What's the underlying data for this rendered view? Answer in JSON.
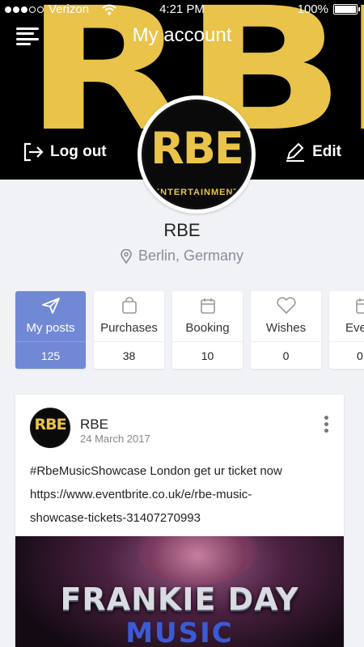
{
  "status_bar": {
    "carrier": "Verizon",
    "time": "4:21 PM",
    "battery": "100%",
    "battery_level": 1.0,
    "signal_bars_filled": 3,
    "signal_bars_total": 5
  },
  "header": {
    "title": "My account",
    "cover_text": "RBE",
    "logout_label": "Log out",
    "edit_label": "Edit"
  },
  "profile": {
    "avatar_text": "RBE",
    "avatar_subtext": "ENTERTAINMENT",
    "name": "RBE",
    "location": "Berlin, Germany"
  },
  "stats": [
    {
      "label": "My posts",
      "value": "125",
      "icon": "send-icon",
      "active": true
    },
    {
      "label": "Purchases",
      "value": "38",
      "icon": "bag-icon",
      "active": false
    },
    {
      "label": "Booking",
      "value": "10",
      "icon": "calendar-icon",
      "active": false
    },
    {
      "label": "Wishes",
      "value": "0",
      "icon": "heart-icon",
      "active": false
    },
    {
      "label": "Eve",
      "value": "0",
      "icon": "calendar-icon",
      "active": false
    }
  ],
  "post": {
    "author": "RBE",
    "avatar_text": "RBE",
    "date": "24 March 2017",
    "text_line1": "#RbeMusicShowcase London get ur ticket now",
    "text_line2": "https://www.eventbrite.co.uk/e/rbe-music-",
    "text_line3": "showcase-tickets-31407270993",
    "image_headline": "FRANKIE DAY",
    "image_sub": "MUSIC"
  },
  "colors": {
    "accent": "#7189d4",
    "brand_yellow": "#e9c34a",
    "background": "#f1f2f6"
  }
}
